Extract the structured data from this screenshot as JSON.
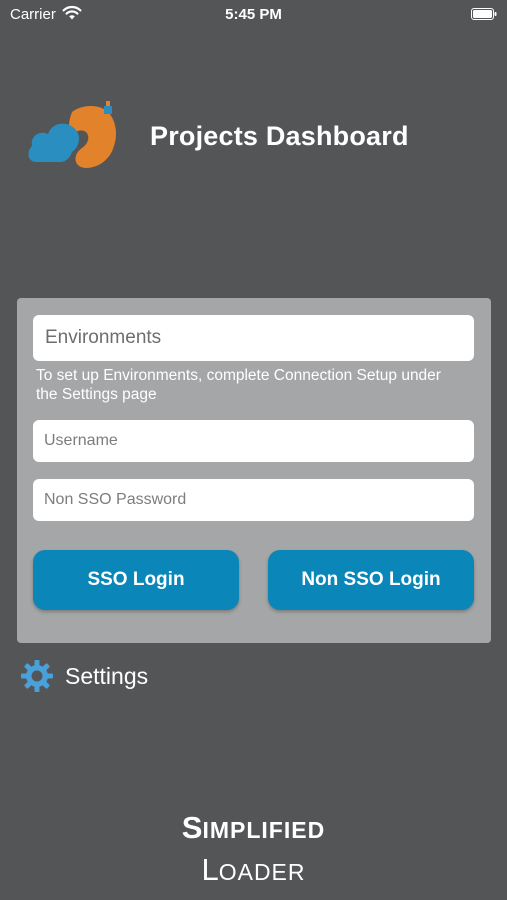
{
  "status_bar": {
    "carrier": "Carrier",
    "time": "5:45 PM",
    "wifi_icon": "wifi-icon",
    "battery_icon": "battery-icon"
  },
  "header": {
    "title": "Projects Dashboard",
    "logo_icon": "cloud-logo-icon"
  },
  "login": {
    "environments_placeholder": "Environments",
    "environments_hint": "To set up Environments, complete Connection Setup under the Settings page",
    "username_placeholder": "Username",
    "password_placeholder": "Non SSO Password",
    "sso_button": "SSO Login",
    "non_sso_button": "Non SSO Login"
  },
  "settings": {
    "label": "Settings",
    "icon": "gear-icon"
  },
  "brand": {
    "line1_initial": "S",
    "line1_rest": "IMPLIFIED",
    "line2_initial": "L",
    "line2_rest": "OADER"
  },
  "colors": {
    "background": "#545556",
    "card": "#a5a6a7",
    "button": "#0a86b8",
    "logo_blue": "#2a8fc0",
    "logo_orange": "#e2822a"
  }
}
